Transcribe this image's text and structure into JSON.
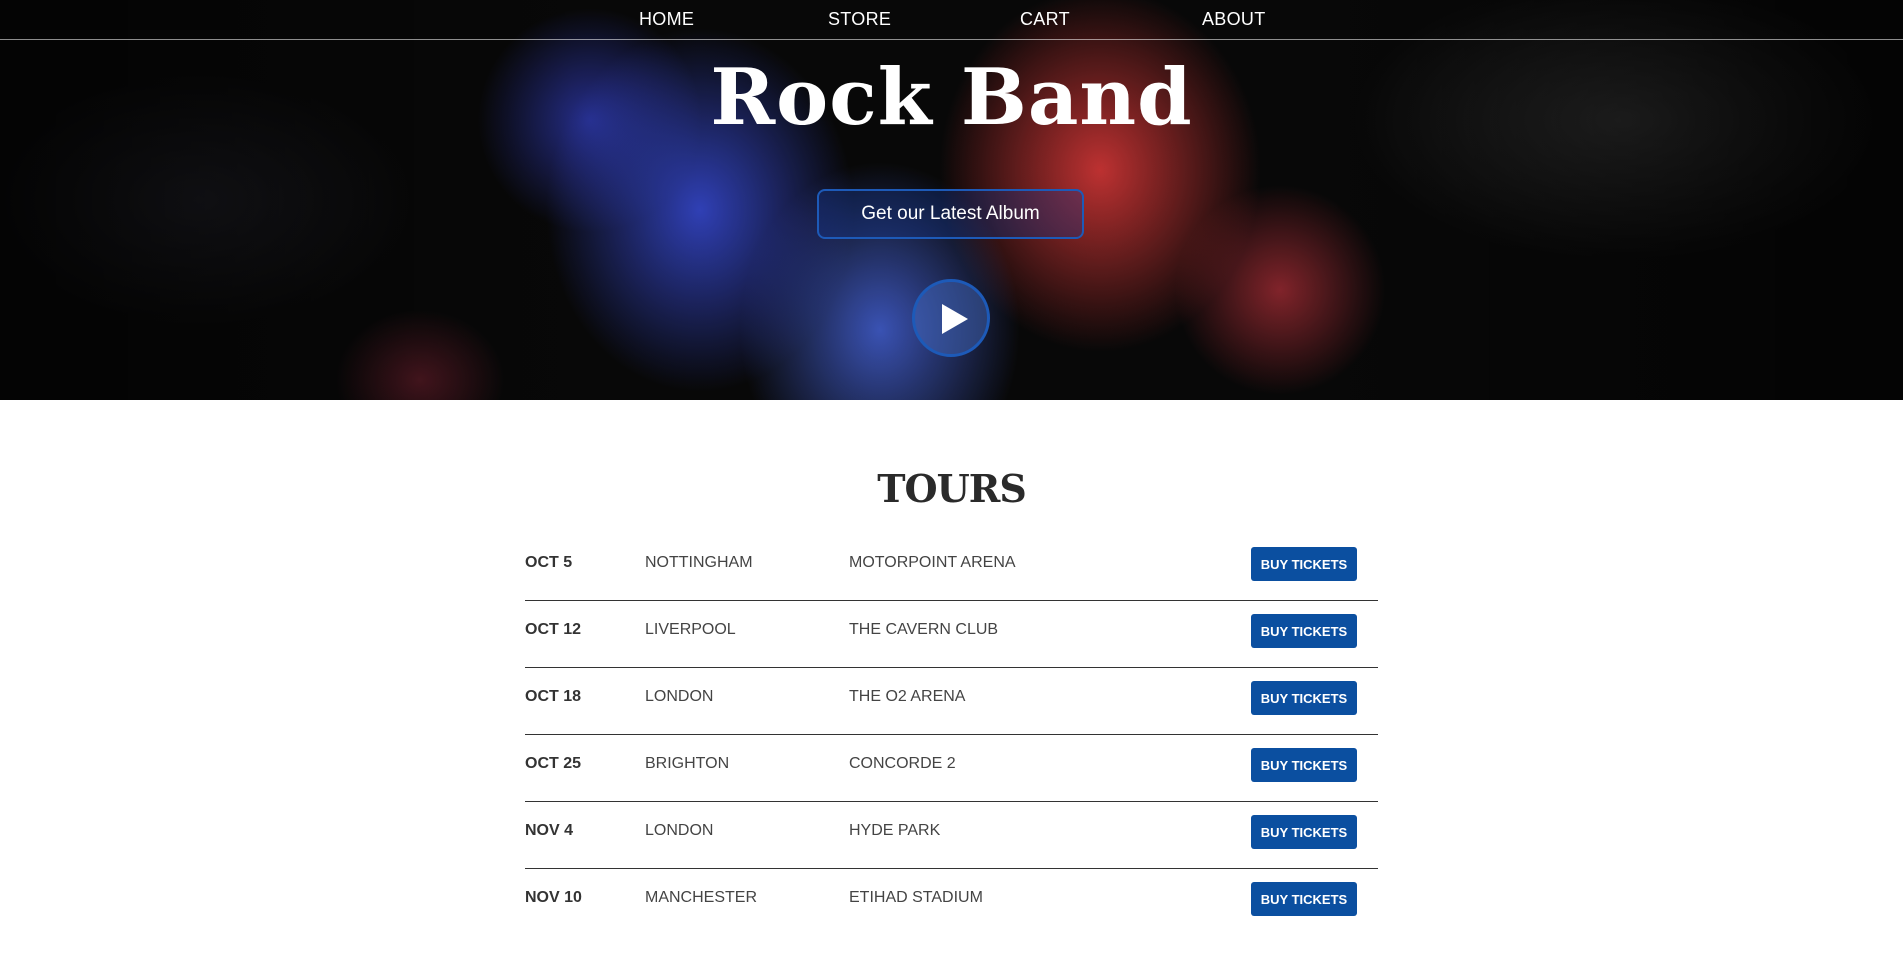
{
  "nav": {
    "items": [
      {
        "label": "HOME"
      },
      {
        "label": "STORE"
      },
      {
        "label": "CART"
      },
      {
        "label": "ABOUT"
      }
    ]
  },
  "hero": {
    "title": "Rock Band",
    "album_button": "Get our Latest Album",
    "play_icon": "play-icon"
  },
  "tours": {
    "title": "TOURS",
    "button_label": "BUY TICKETS",
    "rows": [
      {
        "date": "OCT 5",
        "city": "NOTTINGHAM",
        "venue": "MOTORPOINT ARENA"
      },
      {
        "date": "OCT 12",
        "city": "LIVERPOOL",
        "venue": "THE CAVERN CLUB"
      },
      {
        "date": "OCT 18",
        "city": "LONDON",
        "venue": "THE O2 ARENA"
      },
      {
        "date": "OCT 25",
        "city": "BRIGHTON",
        "venue": "CONCORDE 2"
      },
      {
        "date": "NOV 4",
        "city": "LONDON",
        "venue": "HYDE PARK"
      },
      {
        "date": "NOV 10",
        "city": "MANCHESTER",
        "venue": "ETIHAD STADIUM"
      }
    ]
  },
  "colors": {
    "accent": "#0b4fa0",
    "button_border": "#1d5ab8"
  }
}
